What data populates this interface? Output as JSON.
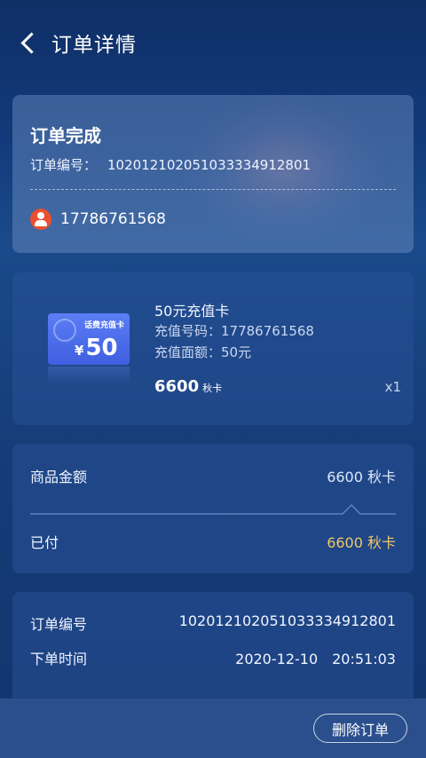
{
  "header": {
    "title": "订单详情"
  },
  "order": {
    "status": "订单完成",
    "number_label": "订单编号：",
    "number_value": "102012102051033334912801",
    "user_phone": "17786761568"
  },
  "product": {
    "thumb_tag": "话费充值卡",
    "thumb_currency": "¥",
    "thumb_amount": "50",
    "name": "50元充值卡",
    "recharge_number": "充值号码：17786761568",
    "face_value": "充值面额：50元",
    "price": "6600",
    "price_unit": "秋卡",
    "quantity": "x1"
  },
  "amounts": {
    "goods_label": "商品金额",
    "goods_value": "6600 秋卡",
    "paid_label": "已付",
    "paid_value": "6600 秋卡"
  },
  "info": {
    "number_label": "订单编号",
    "number_value": "102012102051033334912801",
    "time_label": "下单时间",
    "time_value": "2020-12-10　20:51:03"
  },
  "footer": {
    "delete_label": "删除订单"
  },
  "colors": {
    "accent_gold": "#f2c766",
    "avatar_red": "#e8502f"
  }
}
